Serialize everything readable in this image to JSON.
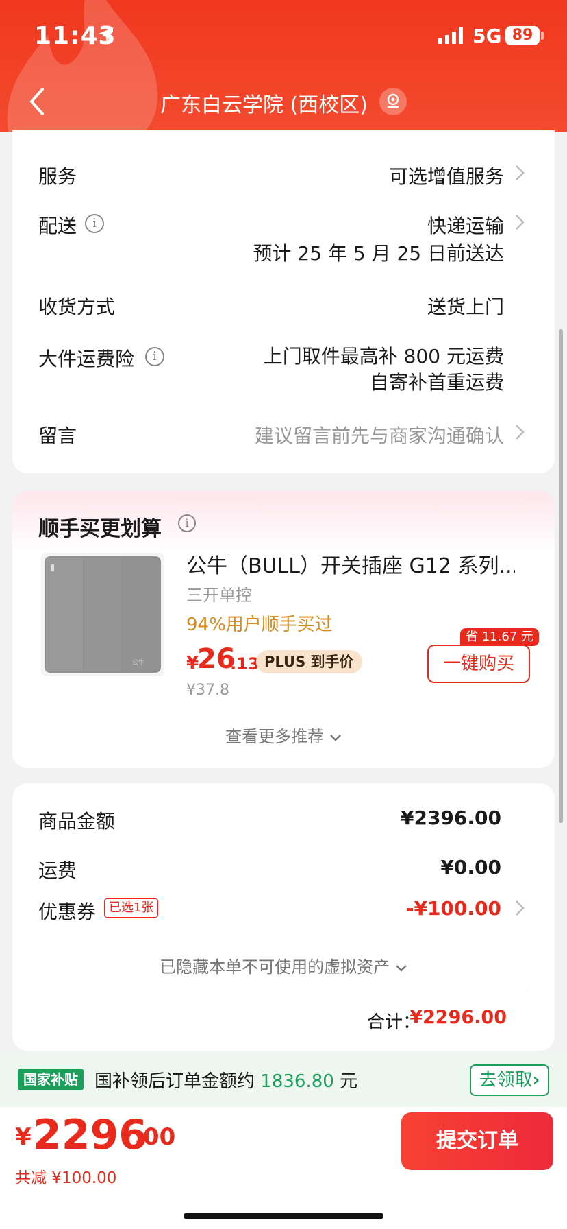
{
  "status_bar": {
    "time": "11:43",
    "network": "5G",
    "battery": "89"
  },
  "nav": {
    "title": "广东白云学院 (西校区)"
  },
  "order_options": {
    "service": {
      "label": "服务",
      "value": "可选增值服务"
    },
    "delivery": {
      "label": "配送",
      "value": "快递运输",
      "eta": "预计 25 年 5 月 25 日前送达"
    },
    "receive": {
      "label": "收货方式",
      "value": "送货上门"
    },
    "insurance": {
      "label": "大件运费险",
      "line1": "上门取件最高补 800 元运费",
      "line2": "自寄补首重运费"
    },
    "message": {
      "label": "留言",
      "placeholder": "建议留言前先与商家沟通确认"
    }
  },
  "recommend": {
    "title": "顺手买更划算",
    "product": {
      "name": "公牛（BULL）开关插座 G12 系列...",
      "spec": "三开单控",
      "bought": "94%用户顺手买过",
      "price_yen": "¥",
      "price_int": "26",
      "price_dec": ".13",
      "plus_label": "PLUS 到手价",
      "original_price": "¥37.8",
      "save_tag": "省 11.67 元",
      "buy_label": "一键购买"
    },
    "more": "查看更多推荐"
  },
  "summary": {
    "goods": {
      "label": "商品金额",
      "value": "¥2396.00"
    },
    "shipping": {
      "label": "运费",
      "value": "¥0.00"
    },
    "coupon": {
      "label": "优惠券",
      "tag": "已选1张",
      "value": "-¥100.00"
    },
    "hidden_assets": "已隐藏本单不可使用的虚拟资产",
    "total_label": "合计：",
    "total_value": "¥2296.00"
  },
  "subsidy": {
    "badge": "国家补贴",
    "text_prefix": "国补领后订单金额约",
    "amount": "1836.80",
    "text_suffix": "元",
    "button": "去领取"
  },
  "checkout": {
    "yen": "¥",
    "int": "2296",
    "dec": ".00",
    "saved": "共减 ¥100.00",
    "submit": "提交订单"
  },
  "colors": {
    "brand_red": "#f0381f",
    "price_red": "#e8291c",
    "green": "#1aa05a"
  }
}
